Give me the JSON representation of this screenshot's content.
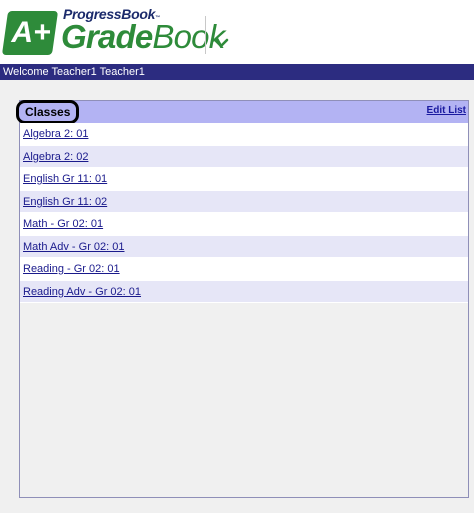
{
  "header": {
    "logo_badge": "A+",
    "brand_small": "ProgressBook",
    "brand_tm": "™",
    "brand_big_bold": "Grade",
    "brand_big_rest": "Book",
    "brand_color": "#2e8b3a",
    "brand_small_color": "#1b2a6b",
    "dropdown_icon": "chevron-down-icon"
  },
  "welcome_bar": {
    "text": "Welcome Teacher1 Teacher1",
    "color": "#2c2c80"
  },
  "classes_panel": {
    "title": "Classes",
    "edit_list_label": "Edit List",
    "header_color": "#b3b3f3",
    "items": [
      {
        "label": "Algebra 2: 01"
      },
      {
        "label": "Algebra 2: 02"
      },
      {
        "label": "English Gr 11: 01"
      },
      {
        "label": "English Gr 11: 02"
      },
      {
        "label": "Math - Gr 02: 01"
      },
      {
        "label": "Math Adv - Gr 02: 01"
      },
      {
        "label": "Reading - Gr 02: 01"
      },
      {
        "label": "Reading Adv - Gr 02: 01"
      }
    ]
  }
}
